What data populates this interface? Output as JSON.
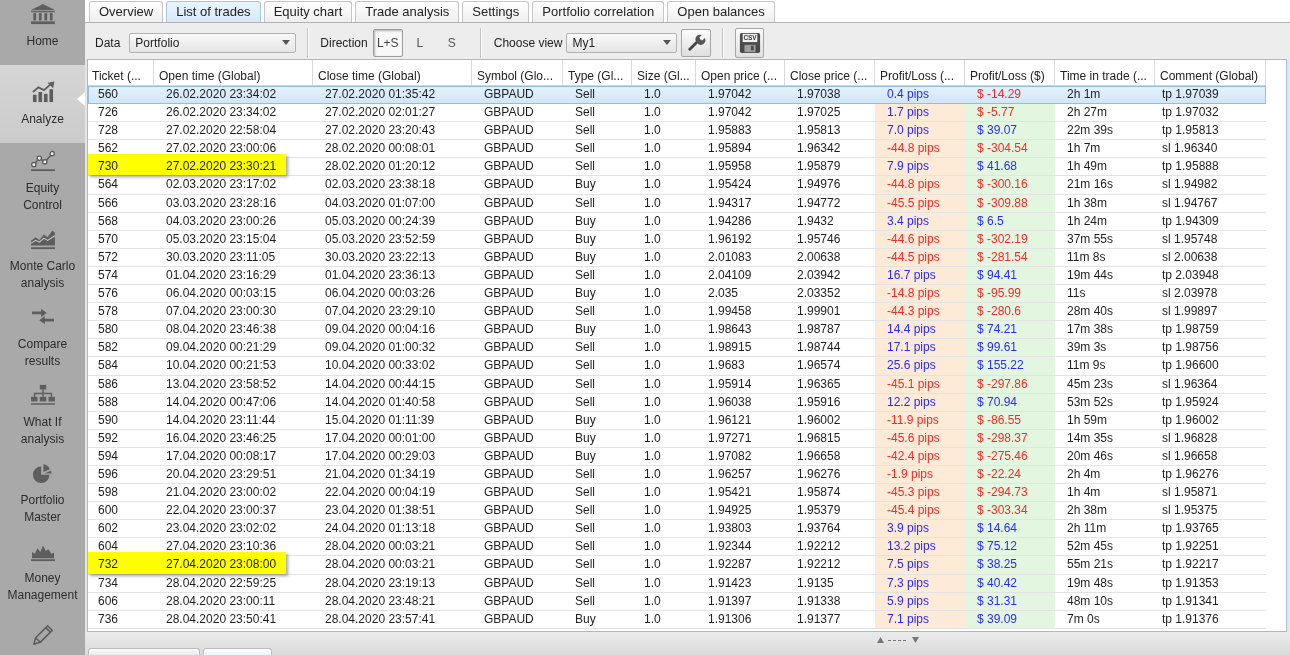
{
  "sidebar": {
    "items": [
      {
        "label": "Home",
        "selected": false
      },
      {
        "label": "Analyze",
        "selected": true
      },
      {
        "label": "Equity Control",
        "selected": false
      },
      {
        "label": "Monte Carlo analysis",
        "selected": false
      },
      {
        "label": "Compare results",
        "selected": false
      },
      {
        "label": "What If analysis",
        "selected": false
      },
      {
        "label": "Portfolio Master",
        "selected": false
      },
      {
        "label": "Money Management",
        "selected": false
      },
      {
        "selected": false
      }
    ]
  },
  "tabs": [
    {
      "label": "Overview",
      "selected": false
    },
    {
      "label": "List of trades",
      "selected": true
    },
    {
      "label": "Equity chart",
      "selected": false
    },
    {
      "label": "Trade analysis",
      "selected": false
    },
    {
      "label": "Settings",
      "selected": false
    },
    {
      "label": "Portfolio correlation",
      "selected": false
    },
    {
      "label": "Open balances",
      "selected": false
    }
  ],
  "toolbar": {
    "data_label": "Data",
    "data_select": "Portfolio",
    "direction_label": "Direction",
    "direction_options": [
      {
        "label": "L+S",
        "selected": true
      },
      {
        "label": "L",
        "selected": false
      },
      {
        "label": "S",
        "selected": false
      }
    ],
    "view_label": "Choose view",
    "view_select": "My1",
    "csv_icon_text": "CSV"
  },
  "table": {
    "columns": [
      "Ticket (...",
      "Open time (Global)",
      "Close time (Global)",
      "Symbol (Glo...",
      "Type (Gl...",
      "Size (Gl...",
      "Open price (...",
      "Close price (...",
      "Profit/Loss (...",
      "Profit/Loss ($)",
      "Time in trade (...",
      "Comment (Global)"
    ],
    "rows": [
      {
        "ticket": "560",
        "open_time": "26.02.2020 23:34:02",
        "close_time": "27.02.2020 01:35:42",
        "symbol": "GBPAUD",
        "type": "Sell",
        "size": "1.0",
        "open_price": "1.97042",
        "close_price": "1.97038",
        "profit_pips": {
          "text": "0.4 pips",
          "negative": false
        },
        "profit_usd": {
          "text": "$ -14.29",
          "negative": true
        },
        "time_in_trade": "2h 1m",
        "comment": "tp 1.97039",
        "selected": true,
        "highlighted": false
      },
      {
        "ticket": "726",
        "open_time": "26.02.2020 23:34:02",
        "close_time": "27.02.2020 02:01:27",
        "symbol": "GBPAUD",
        "type": "Sell",
        "size": "1.0",
        "open_price": "1.97042",
        "close_price": "1.97025",
        "profit_pips": {
          "text": "1.7 pips",
          "negative": false
        },
        "profit_usd": {
          "text": "$ -5.77",
          "negative": true
        },
        "time_in_trade": "2h 27m",
        "comment": "tp 1.97032",
        "selected": false,
        "highlighted": false
      },
      {
        "ticket": "728",
        "open_time": "27.02.2020 22:58:04",
        "close_time": "27.02.2020 23:20:43",
        "symbol": "GBPAUD",
        "type": "Sell",
        "size": "1.0",
        "open_price": "1.95883",
        "close_price": "1.95813",
        "profit_pips": {
          "text": "7.0 pips",
          "negative": false
        },
        "profit_usd": {
          "text": "$ 39.07",
          "negative": false
        },
        "time_in_trade": "22m 39s",
        "comment": "tp 1.95813",
        "selected": false,
        "highlighted": false
      },
      {
        "ticket": "562",
        "open_time": "27.02.2020 23:00:06",
        "close_time": "28.02.2020 00:08:01",
        "symbol": "GBPAUD",
        "type": "Sell",
        "size": "1.0",
        "open_price": "1.95894",
        "close_price": "1.96342",
        "profit_pips": {
          "text": "-44.8 pips",
          "negative": true
        },
        "profit_usd": {
          "text": "$ -304.54",
          "negative": true
        },
        "time_in_trade": "1h 7m",
        "comment": "sl 1.96340",
        "selected": false,
        "highlighted": false
      },
      {
        "ticket": "730",
        "open_time": "27.02.2020 23:30:21",
        "close_time": "28.02.2020 01:20:12",
        "symbol": "GBPAUD",
        "type": "Sell",
        "size": "1.0",
        "open_price": "1.95958",
        "close_price": "1.95879",
        "profit_pips": {
          "text": "7.9 pips",
          "negative": false
        },
        "profit_usd": {
          "text": "$ 41.68",
          "negative": false
        },
        "time_in_trade": "1h 49m",
        "comment": "tp 1.95888",
        "selected": false,
        "highlighted": true
      },
      {
        "ticket": "564",
        "open_time": "02.03.2020 23:17:02",
        "close_time": "02.03.2020 23:38:18",
        "symbol": "GBPAUD",
        "type": "Buy",
        "size": "1.0",
        "open_price": "1.95424",
        "close_price": "1.94976",
        "profit_pips": {
          "text": "-44.8 pips",
          "negative": true
        },
        "profit_usd": {
          "text": "$ -300.16",
          "negative": true
        },
        "time_in_trade": "21m 16s",
        "comment": "sl 1.94982",
        "selected": false,
        "highlighted": false
      },
      {
        "ticket": "566",
        "open_time": "03.03.2020 23:28:16",
        "close_time": "04.03.2020 01:07:00",
        "symbol": "GBPAUD",
        "type": "Sell",
        "size": "1.0",
        "open_price": "1.94317",
        "close_price": "1.94772",
        "profit_pips": {
          "text": "-45.5 pips",
          "negative": true
        },
        "profit_usd": {
          "text": "$ -309.88",
          "negative": true
        },
        "time_in_trade": "1h 38m",
        "comment": "sl 1.94767",
        "selected": false,
        "highlighted": false
      },
      {
        "ticket": "568",
        "open_time": "04.03.2020 23:00:26",
        "close_time": "05.03.2020 00:24:39",
        "symbol": "GBPAUD",
        "type": "Buy",
        "size": "1.0",
        "open_price": "1.94286",
        "close_price": "1.9432",
        "profit_pips": {
          "text": "3.4 pips",
          "negative": false
        },
        "profit_usd": {
          "text": "$ 6.5",
          "negative": false
        },
        "time_in_trade": "1h 24m",
        "comment": "tp 1.94309",
        "selected": false,
        "highlighted": false
      },
      {
        "ticket": "570",
        "open_time": "05.03.2020 23:15:04",
        "close_time": "05.03.2020 23:52:59",
        "symbol": "GBPAUD",
        "type": "Buy",
        "size": "1.0",
        "open_price": "1.96192",
        "close_price": "1.95746",
        "profit_pips": {
          "text": "-44.6 pips",
          "negative": true
        },
        "profit_usd": {
          "text": "$ -302.19",
          "negative": true
        },
        "time_in_trade": "37m 55s",
        "comment": "sl 1.95748",
        "selected": false,
        "highlighted": false
      },
      {
        "ticket": "572",
        "open_time": "30.03.2020 23:11:05",
        "close_time": "30.03.2020 23:22:13",
        "symbol": "GBPAUD",
        "type": "Buy",
        "size": "1.0",
        "open_price": "2.01083",
        "close_price": "2.00638",
        "profit_pips": {
          "text": "-44.5 pips",
          "negative": true
        },
        "profit_usd": {
          "text": "$ -281.54",
          "negative": true
        },
        "time_in_trade": "11m 8s",
        "comment": "sl 2.00638",
        "selected": false,
        "highlighted": false
      },
      {
        "ticket": "574",
        "open_time": "01.04.2020 23:16:29",
        "close_time": "01.04.2020 23:36:13",
        "symbol": "GBPAUD",
        "type": "Sell",
        "size": "1.0",
        "open_price": "2.04109",
        "close_price": "2.03942",
        "profit_pips": {
          "text": "16.7 pips",
          "negative": false
        },
        "profit_usd": {
          "text": "$ 94.41",
          "negative": false
        },
        "time_in_trade": "19m 44s",
        "comment": "tp 2.03948",
        "selected": false,
        "highlighted": false
      },
      {
        "ticket": "576",
        "open_time": "06.04.2020 00:03:15",
        "close_time": "06.04.2020 00:03:26",
        "symbol": "GBPAUD",
        "type": "Buy",
        "size": "1.0",
        "open_price": "2.035",
        "close_price": "2.03352",
        "profit_pips": {
          "text": "-14.8 pips",
          "negative": true
        },
        "profit_usd": {
          "text": "$ -95.99",
          "negative": true
        },
        "time_in_trade": "11s",
        "comment": "sl 2.03978",
        "selected": false,
        "highlighted": false
      },
      {
        "ticket": "578",
        "open_time": "07.04.2020 23:00:30",
        "close_time": "07.04.2020 23:29:10",
        "symbol": "GBPAUD",
        "type": "Sell",
        "size": "1.0",
        "open_price": "1.99458",
        "close_price": "1.99901",
        "profit_pips": {
          "text": "-44.3 pips",
          "negative": true
        },
        "profit_usd": {
          "text": "$ -280.6",
          "negative": true
        },
        "time_in_trade": "28m 40s",
        "comment": "sl 1.99897",
        "selected": false,
        "highlighted": false
      },
      {
        "ticket": "580",
        "open_time": "08.04.2020 23:46:38",
        "close_time": "09.04.2020 00:04:16",
        "symbol": "GBPAUD",
        "type": "Buy",
        "size": "1.0",
        "open_price": "1.98643",
        "close_price": "1.98787",
        "profit_pips": {
          "text": "14.4 pips",
          "negative": false
        },
        "profit_usd": {
          "text": "$ 74.21",
          "negative": false
        },
        "time_in_trade": "17m 38s",
        "comment": "tp 1.98759",
        "selected": false,
        "highlighted": false
      },
      {
        "ticket": "582",
        "open_time": "09.04.2020 00:21:29",
        "close_time": "09.04.2020 01:00:32",
        "symbol": "GBPAUD",
        "type": "Sell",
        "size": "1.0",
        "open_price": "1.98915",
        "close_price": "1.98744",
        "profit_pips": {
          "text": "17.1 pips",
          "negative": false
        },
        "profit_usd": {
          "text": "$ 99.61",
          "negative": false
        },
        "time_in_trade": "39m 3s",
        "comment": "tp 1.98756",
        "selected": false,
        "highlighted": false
      },
      {
        "ticket": "584",
        "open_time": "10.04.2020 00:21:53",
        "close_time": "10.04.2020 00:33:02",
        "symbol": "GBPAUD",
        "type": "Sell",
        "size": "1.0",
        "open_price": "1.9683",
        "close_price": "1.96574",
        "profit_pips": {
          "text": "25.6 pips",
          "negative": false
        },
        "profit_usd": {
          "text": "$ 155.22",
          "negative": false
        },
        "time_in_trade": "11m 9s",
        "comment": "tp 1.96600",
        "selected": false,
        "highlighted": false
      },
      {
        "ticket": "586",
        "open_time": "13.04.2020 23:58:52",
        "close_time": "14.04.2020 00:44:15",
        "symbol": "GBPAUD",
        "type": "Sell",
        "size": "1.0",
        "open_price": "1.95914",
        "close_price": "1.96365",
        "profit_pips": {
          "text": "-45.1 pips",
          "negative": true
        },
        "profit_usd": {
          "text": "$ -297.86",
          "negative": true
        },
        "time_in_trade": "45m 23s",
        "comment": "sl 1.96364",
        "selected": false,
        "highlighted": false
      },
      {
        "ticket": "588",
        "open_time": "14.04.2020 00:47:06",
        "close_time": "14.04.2020 01:40:58",
        "symbol": "GBPAUD",
        "type": "Sell",
        "size": "1.0",
        "open_price": "1.96038",
        "close_price": "1.95916",
        "profit_pips": {
          "text": "12.2 pips",
          "negative": false
        },
        "profit_usd": {
          "text": "$ 70.94",
          "negative": false
        },
        "time_in_trade": "53m 52s",
        "comment": "tp 1.95924",
        "selected": false,
        "highlighted": false
      },
      {
        "ticket": "590",
        "open_time": "14.04.2020 23:11:44",
        "close_time": "15.04.2020 01:11:39",
        "symbol": "GBPAUD",
        "type": "Buy",
        "size": "1.0",
        "open_price": "1.96121",
        "close_price": "1.96002",
        "profit_pips": {
          "text": "-11.9 pips",
          "negative": true
        },
        "profit_usd": {
          "text": "$ -86.55",
          "negative": true
        },
        "time_in_trade": "1h 59m",
        "comment": "tp 1.96002",
        "selected": false,
        "highlighted": false
      },
      {
        "ticket": "592",
        "open_time": "16.04.2020 23:46:25",
        "close_time": "17.04.2020 00:01:00",
        "symbol": "GBPAUD",
        "type": "Buy",
        "size": "1.0",
        "open_price": "1.97271",
        "close_price": "1.96815",
        "profit_pips": {
          "text": "-45.6 pips",
          "negative": true
        },
        "profit_usd": {
          "text": "$ -298.37",
          "negative": true
        },
        "time_in_trade": "14m 35s",
        "comment": "sl 1.96828",
        "selected": false,
        "highlighted": false
      },
      {
        "ticket": "594",
        "open_time": "17.04.2020 00:08:17",
        "close_time": "17.04.2020 00:29:03",
        "symbol": "GBPAUD",
        "type": "Buy",
        "size": "1.0",
        "open_price": "1.97082",
        "close_price": "1.96658",
        "profit_pips": {
          "text": "-42.4 pips",
          "negative": true
        },
        "profit_usd": {
          "text": "$ -275.46",
          "negative": true
        },
        "time_in_trade": "20m 46s",
        "comment": "sl 1.96658",
        "selected": false,
        "highlighted": false
      },
      {
        "ticket": "596",
        "open_time": "20.04.2020 23:29:51",
        "close_time": "21.04.2020 01:34:19",
        "symbol": "GBPAUD",
        "type": "Sell",
        "size": "1.0",
        "open_price": "1.96257",
        "close_price": "1.96276",
        "profit_pips": {
          "text": "-1.9 pips",
          "negative": true
        },
        "profit_usd": {
          "text": "$ -22.24",
          "negative": true
        },
        "time_in_trade": "2h 4m",
        "comment": "tp 1.96276",
        "selected": false,
        "highlighted": false
      },
      {
        "ticket": "598",
        "open_time": "21.04.2020 23:00:02",
        "close_time": "22.04.2020 00:04:19",
        "symbol": "GBPAUD",
        "type": "Sell",
        "size": "1.0",
        "open_price": "1.95421",
        "close_price": "1.95874",
        "profit_pips": {
          "text": "-45.3 pips",
          "negative": true
        },
        "profit_usd": {
          "text": "$ -294.73",
          "negative": true
        },
        "time_in_trade": "1h 4m",
        "comment": "sl 1.95871",
        "selected": false,
        "highlighted": false
      },
      {
        "ticket": "600",
        "open_time": "22.04.2020 23:00:37",
        "close_time": "23.04.2020 01:38:51",
        "symbol": "GBPAUD",
        "type": "Sell",
        "size": "1.0",
        "open_price": "1.94925",
        "close_price": "1.95379",
        "profit_pips": {
          "text": "-45.4 pips",
          "negative": true
        },
        "profit_usd": {
          "text": "$ -303.34",
          "negative": true
        },
        "time_in_trade": "2h 38m",
        "comment": "sl 1.95375",
        "selected": false,
        "highlighted": false
      },
      {
        "ticket": "602",
        "open_time": "23.04.2020 23:02:02",
        "close_time": "24.04.2020 01:13:18",
        "symbol": "GBPAUD",
        "type": "Sell",
        "size": "1.0",
        "open_price": "1.93803",
        "close_price": "1.93764",
        "profit_pips": {
          "text": "3.9 pips",
          "negative": false
        },
        "profit_usd": {
          "text": "$ 14.64",
          "negative": false
        },
        "time_in_trade": "2h 11m",
        "comment": "tp 1.93765",
        "selected": false,
        "highlighted": false
      },
      {
        "ticket": "604",
        "open_time": "27.04.2020 23:10:36",
        "close_time": "28.04.2020 00:03:21",
        "symbol": "GBPAUD",
        "type": "Sell",
        "size": "1.0",
        "open_price": "1.92344",
        "close_price": "1.92212",
        "profit_pips": {
          "text": "13.2 pips",
          "negative": false
        },
        "profit_usd": {
          "text": "$ 75.12",
          "negative": false
        },
        "time_in_trade": "52m 45s",
        "comment": "tp 1.92251",
        "selected": false,
        "highlighted": false
      },
      {
        "ticket": "732",
        "open_time": "27.04.2020 23:08:00",
        "close_time": "28.04.2020 00:03:21",
        "symbol": "GBPAUD",
        "type": "Sell",
        "size": "1.0",
        "open_price": "1.92287",
        "close_price": "1.92212",
        "profit_pips": {
          "text": "7.5 pips",
          "negative": false
        },
        "profit_usd": {
          "text": "$ 38.25",
          "negative": false
        },
        "time_in_trade": "55m 21s",
        "comment": "tp 1.92217",
        "selected": false,
        "highlighted": true
      },
      {
        "ticket": "734",
        "open_time": "28.04.2020 22:59:25",
        "close_time": "28.04.2020 23:19:13",
        "symbol": "GBPAUD",
        "type": "Sell",
        "size": "1.0",
        "open_price": "1.91423",
        "close_price": "1.9135",
        "profit_pips": {
          "text": "7.3 pips",
          "negative": false
        },
        "profit_usd": {
          "text": "$ 40.42",
          "negative": false
        },
        "time_in_trade": "19m 48s",
        "comment": "tp 1.91353",
        "selected": false,
        "highlighted": false
      },
      {
        "ticket": "606",
        "open_time": "28.04.2020 23:00:11",
        "close_time": "28.04.2020 23:48:21",
        "symbol": "GBPAUD",
        "type": "Sell",
        "size": "1.0",
        "open_price": "1.91397",
        "close_price": "1.91338",
        "profit_pips": {
          "text": "5.9 pips",
          "negative": false
        },
        "profit_usd": {
          "text": "$ 31.31",
          "negative": false
        },
        "time_in_trade": "48m 10s",
        "comment": "tp 1.91341",
        "selected": false,
        "highlighted": false
      },
      {
        "ticket": "736",
        "open_time": "28.04.2020 23:50:41",
        "close_time": "28.04.2020 23:57:41",
        "symbol": "GBPAUD",
        "type": "Buy",
        "size": "1.0",
        "open_price": "1.91306",
        "close_price": "1.91377",
        "profit_pips": {
          "text": "7.1 pips",
          "negative": false
        },
        "profit_usd": {
          "text": "$ 39.09",
          "negative": false
        },
        "time_in_trade": "7m 0s",
        "comment": "tp 1.91376",
        "selected": false,
        "highlighted": false
      }
    ]
  }
}
